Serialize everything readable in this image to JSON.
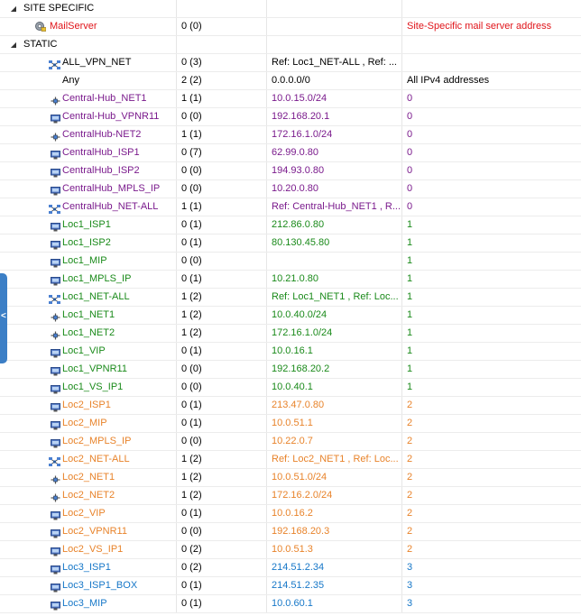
{
  "colors": {
    "special": "#e0141a",
    "purple": "#7a1a8c",
    "green": "#1a8a1a",
    "orange": "#e8832a",
    "blue": "#1677c8",
    "black": "#000000"
  },
  "groups": [
    {
      "label": "SITE SPECIFIC",
      "expanded": true,
      "rows": [
        {
          "name": "MailServer",
          "icon": "mail-server-icon",
          "count": "0 (0)",
          "value": "",
          "site": "Site-Specific mail server address",
          "color": "special"
        }
      ]
    },
    {
      "label": "STATIC",
      "expanded": true,
      "rows": [
        {
          "name": "ALL_VPN_NET",
          "icon": "network-group-icon",
          "count": "0 (3)",
          "value": "Ref: Loc1_NET-ALL , Ref: ...",
          "site": "",
          "color": "black"
        },
        {
          "name": "Any",
          "icon": "",
          "count": "2 (2)",
          "value": "0.0.0.0/0",
          "site": "All IPv4 addresses",
          "color": "black"
        },
        {
          "name": "Central-Hub_NET1",
          "icon": "network-icon",
          "count": "1 (1)",
          "value": "10.0.15.0/24",
          "site": "0",
          "color": "purple"
        },
        {
          "name": "Central-Hub_VPNR11",
          "icon": "host-icon",
          "count": "0 (0)",
          "value": "192.168.20.1",
          "site": "0",
          "color": "purple"
        },
        {
          "name": "CentralHub-NET2",
          "icon": "network-icon",
          "count": "1 (1)",
          "value": "172.16.1.0/24",
          "site": "0",
          "color": "purple"
        },
        {
          "name": "CentralHub_ISP1",
          "icon": "host-icon",
          "count": "0 (7)",
          "value": "62.99.0.80",
          "site": "0",
          "color": "purple"
        },
        {
          "name": "CentralHub_ISP2",
          "icon": "host-icon",
          "count": "0 (0)",
          "value": "194.93.0.80",
          "site": "0",
          "color": "purple"
        },
        {
          "name": "CentralHub_MPLS_IP",
          "icon": "host-icon",
          "count": "0 (0)",
          "value": "10.20.0.80",
          "site": "0",
          "color": "purple"
        },
        {
          "name": "CentralHub_NET-ALL",
          "icon": "network-group-icon",
          "count": "1 (1)",
          "value": "Ref: Central-Hub_NET1 , R...",
          "site": "0",
          "color": "purple"
        },
        {
          "name": "Loc1_ISP1",
          "icon": "host-icon",
          "count": "0 (1)",
          "value": "212.86.0.80",
          "site": "1",
          "color": "green"
        },
        {
          "name": "Loc1_ISP2",
          "icon": "host-icon",
          "count": "0 (1)",
          "value": "80.130.45.80",
          "site": "1",
          "color": "green"
        },
        {
          "name": "Loc1_MIP",
          "icon": "host-icon",
          "count": "0 (0)",
          "value": "",
          "site": "1",
          "color": "green"
        },
        {
          "name": "Loc1_MPLS_IP",
          "icon": "host-icon",
          "count": "0 (1)",
          "value": "10.21.0.80",
          "site": "1",
          "color": "green"
        },
        {
          "name": "Loc1_NET-ALL",
          "icon": "network-group-icon",
          "count": "1 (2)",
          "value": "Ref: Loc1_NET1 , Ref: Loc...",
          "site": "1",
          "color": "green"
        },
        {
          "name": "Loc1_NET1",
          "icon": "network-icon",
          "count": "1 (2)",
          "value": "10.0.40.0/24",
          "site": "1",
          "color": "green"
        },
        {
          "name": "Loc1_NET2",
          "icon": "network-icon",
          "count": "1 (2)",
          "value": "172.16.1.0/24",
          "site": "1",
          "color": "green"
        },
        {
          "name": "Loc1_VIP",
          "icon": "host-icon",
          "count": "0 (1)",
          "value": "10.0.16.1",
          "site": "1",
          "color": "green"
        },
        {
          "name": "Loc1_VPNR11",
          "icon": "host-icon",
          "count": "0 (0)",
          "value": "192.168.20.2",
          "site": "1",
          "color": "green"
        },
        {
          "name": "Loc1_VS_IP1",
          "icon": "host-icon",
          "count": "0 (0)",
          "value": "10.0.40.1",
          "site": "1",
          "color": "green"
        },
        {
          "name": "Loc2_ISP1",
          "icon": "host-icon",
          "count": "0 (1)",
          "value": "213.47.0.80",
          "site": "2",
          "color": "orange"
        },
        {
          "name": "Loc2_MIP",
          "icon": "host-icon",
          "count": "0 (1)",
          "value": "10.0.51.1",
          "site": "2",
          "color": "orange"
        },
        {
          "name": "Loc2_MPLS_IP",
          "icon": "host-icon",
          "count": "0 (0)",
          "value": "10.22.0.7",
          "site": "2",
          "color": "orange"
        },
        {
          "name": "Loc2_NET-ALL",
          "icon": "network-group-icon",
          "count": "1 (2)",
          "value": "Ref: Loc2_NET1 , Ref: Loc...",
          "site": "2",
          "color": "orange"
        },
        {
          "name": "Loc2_NET1",
          "icon": "network-icon",
          "count": "1 (2)",
          "value": "10.0.51.0/24",
          "site": "2",
          "color": "orange"
        },
        {
          "name": "Loc2_NET2",
          "icon": "network-icon",
          "count": "1 (2)",
          "value": "172.16.2.0/24",
          "site": "2",
          "color": "orange"
        },
        {
          "name": "Loc2_VIP",
          "icon": "host-icon",
          "count": "0 (1)",
          "value": "10.0.16.2",
          "site": "2",
          "color": "orange"
        },
        {
          "name": "Loc2_VPNR11",
          "icon": "host-icon",
          "count": "0 (0)",
          "value": "192.168.20.3",
          "site": "2",
          "color": "orange"
        },
        {
          "name": "Loc2_VS_IP1",
          "icon": "host-icon",
          "count": "0 (2)",
          "value": "10.0.51.3",
          "site": "2",
          "color": "orange"
        },
        {
          "name": "Loc3_ISP1",
          "icon": "host-icon",
          "count": "0 (2)",
          "value": "214.51.2.34",
          "site": "3",
          "color": "blue"
        },
        {
          "name": "Loc3_ISP1_BOX",
          "icon": "host-icon",
          "count": "0 (1)",
          "value": "214.51.2.35",
          "site": "3",
          "color": "blue"
        },
        {
          "name": "Loc3_MIP",
          "icon": "host-icon",
          "count": "0 (1)",
          "value": "10.0.60.1",
          "site": "3",
          "color": "blue"
        }
      ]
    }
  ],
  "side_tab": {
    "glyph": "<"
  }
}
